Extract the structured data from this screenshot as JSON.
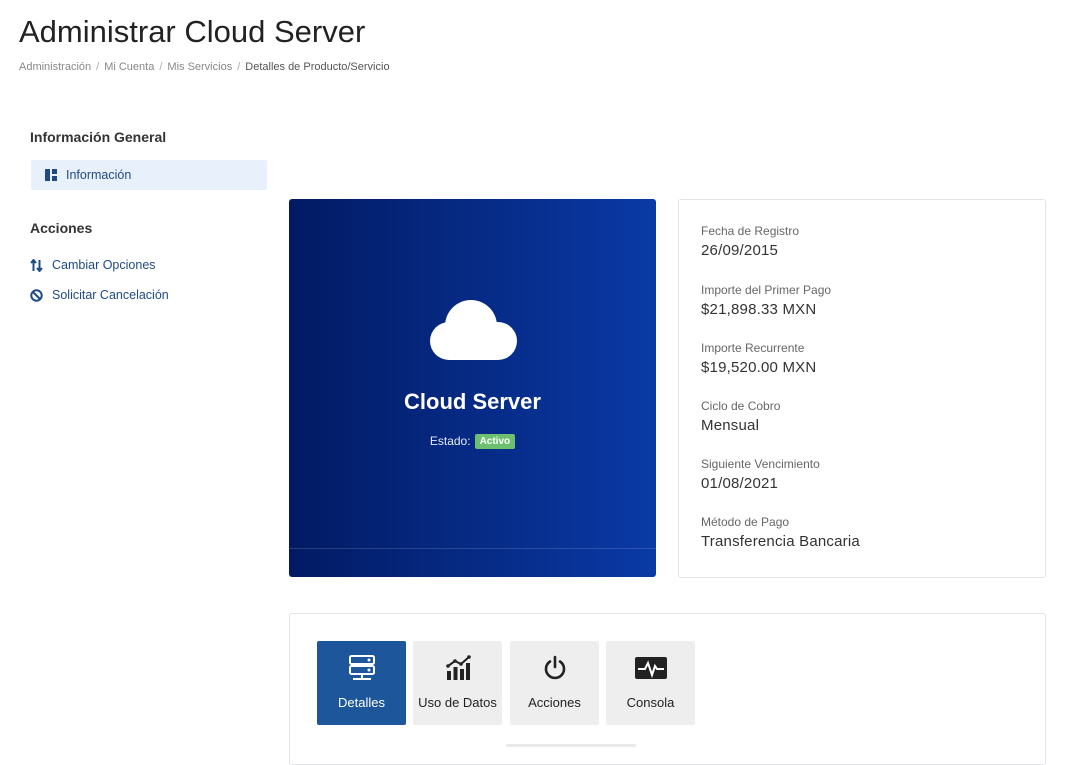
{
  "header": {
    "title": "Administrar Cloud Server",
    "breadcrumb": [
      "Administración",
      "Mi Cuenta",
      "Mis Servicios"
    ],
    "breadcrumb_current": "Detalles de Producto/Servicio"
  },
  "sidebar": {
    "general_heading": "Información General",
    "general_items": [
      {
        "label": "Información",
        "icon": "dashboard-icon"
      }
    ],
    "actions_heading": "Acciones",
    "action_items": [
      {
        "label": "Cambiar Opciones",
        "icon": "swap-icon"
      },
      {
        "label": "Solicitar Cancelación",
        "icon": "ban-icon"
      }
    ]
  },
  "product": {
    "name": "Cloud Server",
    "status_label": "Estado:",
    "status_value": "Activo",
    "icon": "cloud-icon",
    "gradient_start": "#021a63",
    "gradient_end": "#0a3aa6",
    "status_color": "#6cc070"
  },
  "details": {
    "items": [
      {
        "label": "Fecha de Registro",
        "value": "26/09/2015"
      },
      {
        "label": "Importe del Primer Pago",
        "value": "$21,898.33 MXN"
      },
      {
        "label": "Importe Recurrente",
        "value": "$19,520.00 MXN"
      },
      {
        "label": "Ciclo de Cobro",
        "value": "Mensual"
      },
      {
        "label": "Siguiente Vencimiento",
        "value": "01/08/2021"
      },
      {
        "label": "Método de Pago",
        "value": "Transferencia Bancaria"
      }
    ]
  },
  "tabs": [
    {
      "label": "Detalles",
      "icon": "server-icon",
      "active": true
    },
    {
      "label": "Uso de Datos",
      "icon": "bar-chart-icon",
      "active": false
    },
    {
      "label": "Acciones",
      "icon": "power-icon",
      "active": false
    },
    {
      "label": "Consola",
      "icon": "terminal-pulse-icon",
      "active": false
    }
  ],
  "theme": {
    "accent": "#1e569b",
    "link": "#1f4a86"
  }
}
